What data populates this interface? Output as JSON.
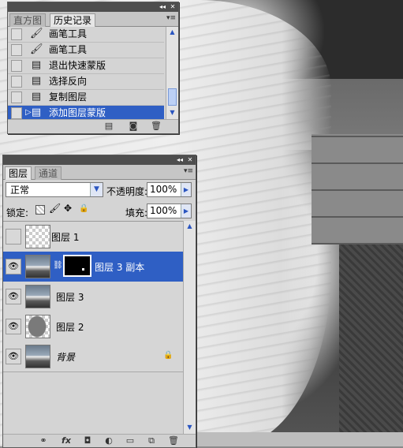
{
  "history_panel": {
    "tabs": [
      {
        "label": "直方图",
        "active": false
      },
      {
        "label": "历史记录",
        "active": true
      }
    ],
    "items": [
      {
        "label": "画笔工具",
        "icon": "brush-icon",
        "selected": false
      },
      {
        "label": "画笔工具",
        "icon": "brush-icon",
        "selected": false
      },
      {
        "label": "退出快速蒙版",
        "icon": "document-icon",
        "selected": false
      },
      {
        "label": "选择反向",
        "icon": "document-icon",
        "selected": false
      },
      {
        "label": "复制图层",
        "icon": "document-icon",
        "selected": false
      },
      {
        "label": "添加图层蒙版",
        "icon": "document-icon",
        "selected": true
      }
    ],
    "footer_icons": [
      "new-document-from-state-icon",
      "snapshot-camera-icon",
      "trash-icon"
    ]
  },
  "layers_panel": {
    "tabs": [
      {
        "label": "图层",
        "active": true
      },
      {
        "label": "通道",
        "active": false
      }
    ],
    "blend_mode": "正常",
    "opacity_label": "不透明度:",
    "opacity_value": "100%",
    "lock_label": "锁定:",
    "lock_icons": [
      "lock-transparency-icon",
      "lock-brush-icon",
      "lock-move-icon",
      "lock-all-icon"
    ],
    "fill_label": "填充:",
    "fill_value": "100%",
    "layers": [
      {
        "name": "图层 1",
        "visible": false,
        "thumb": "transparent",
        "has_mask": false,
        "selected": false,
        "locked": false,
        "italic": false
      },
      {
        "name": "图层 3 副本",
        "visible": true,
        "thumb": "photo",
        "has_mask": true,
        "selected": true,
        "locked": false,
        "italic": false
      },
      {
        "name": "图层 3",
        "visible": true,
        "thumb": "photo",
        "has_mask": false,
        "selected": false,
        "locked": false,
        "italic": false
      },
      {
        "name": "图层 2",
        "visible": true,
        "thumb": "shape",
        "has_mask": false,
        "selected": false,
        "locked": false,
        "italic": false
      },
      {
        "name": "背景",
        "visible": true,
        "thumb": "photo",
        "has_mask": false,
        "selected": false,
        "locked": true,
        "italic": true
      }
    ],
    "footer_icons": [
      "link-layers-icon",
      "fx-icon",
      "add-mask-icon",
      "adjustment-layer-icon",
      "new-group-icon",
      "new-layer-icon",
      "trash-icon"
    ]
  },
  "colors": {
    "selection": "#2f5fc4",
    "panel_bg": "#d4d4d4",
    "titlebar": "#4e4e4e"
  }
}
